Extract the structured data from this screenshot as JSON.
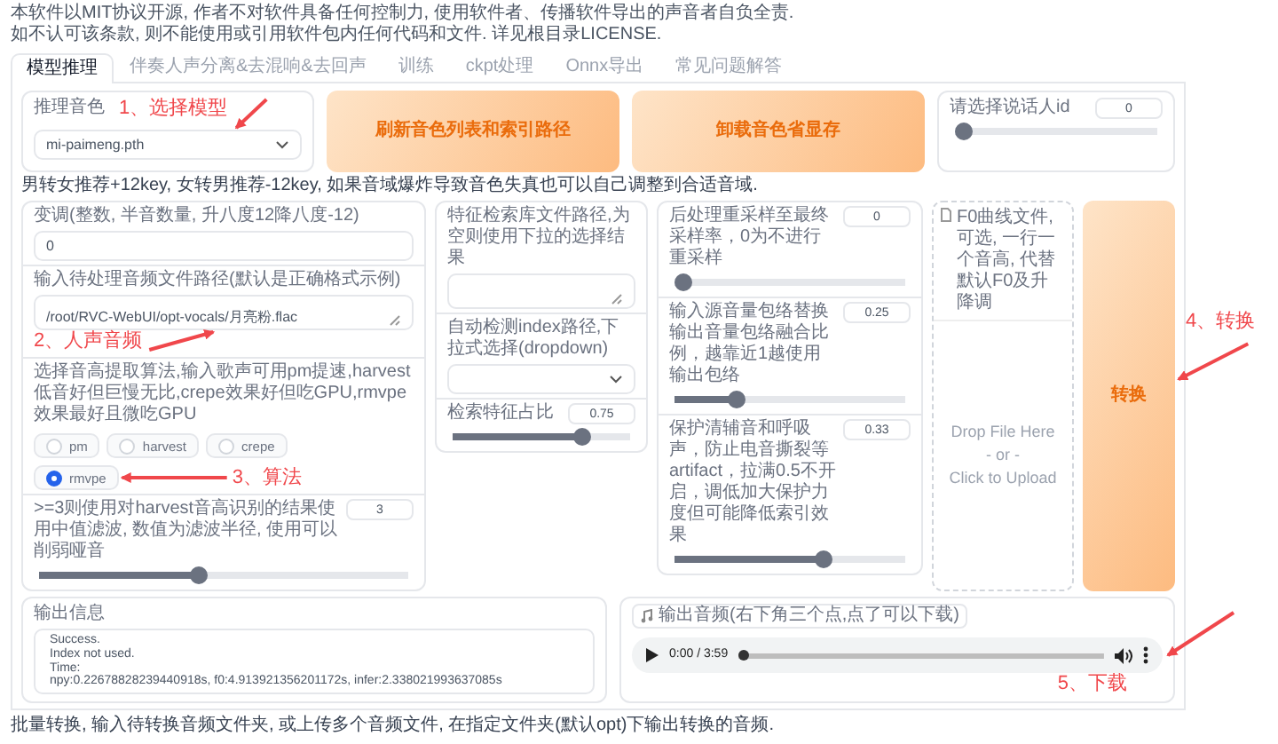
{
  "notice": [
    "本软件以MIT协议开源, 作者不对软件具备任何控制力, 使用软件者、传播软件导出的声音者自负全责.",
    "如不认可该条款, 则不能使用或引用软件包内任何代码和文件. 详见根目录LICENSE."
  ],
  "tabs": [
    {
      "label": "模型推理",
      "selected": true
    },
    {
      "label": "伴奏人声分离&去混响&去回声",
      "selected": false
    },
    {
      "label": "训练",
      "selected": false
    },
    {
      "label": "ckpt处理",
      "selected": false
    },
    {
      "label": "Onnx导出",
      "selected": false
    },
    {
      "label": "常见问题解答",
      "selected": false
    }
  ],
  "model": {
    "label": "推理音色",
    "value": "mi-paimeng.pth"
  },
  "buttons": [
    "刷新音色列表和索引路径",
    "卸载音色省显存"
  ],
  "speaker": {
    "label": "请选择说话人id",
    "value": "0",
    "level": 0
  },
  "hint": "男转女推荐+12key, 女转男推荐-12key, 如果音域爆炸导致音色失真也可以自己调整到合适音域.",
  "columns": [
    [
      {
        "kind": "number",
        "label": "变调(整数, 半音数量, 升八度12降八度-12)",
        "value": "0"
      },
      {
        "kind": "textbox",
        "label": "输入待处理音频文件路径(默认是正确格式示例)",
        "value": "/root/RVC-WebUI/opt-vocals/月亮粉.flac"
      },
      {
        "kind": "radio",
        "label": "选择音高提取算法,输入歌声可用pm提速,harvest低音好但巨慢无比,crepe效果好但吃GPU,rmvpe效果最好且微吃GPU",
        "options": [
          {
            "label": "pm",
            "selected": false
          },
          {
            "label": "harvest",
            "selected": false
          },
          {
            "label": "crepe",
            "selected": false
          },
          {
            "label": "rmvpe",
            "selected": true
          }
        ]
      },
      {
        "kind": "slider",
        "label": ">=3则使用对harvest音高识别的结果使用中值滤波, 数值为滤波半径, 使用可以削弱哑音",
        "value": "3",
        "level": 0.43
      }
    ],
    [
      {
        "kind": "textbox",
        "label": "特征检索库文件路径,为空则使用下拉的选择结果"
      },
      {
        "kind": "dropdown",
        "label": "自动检测index路径,下拉式选择(dropdown)"
      },
      {
        "kind": "slider",
        "label": "检索特征占比",
        "value": "0.75",
        "level": 0.75
      }
    ],
    [
      {
        "kind": "slider",
        "label": "后处理重采样至最终采样率，0为不进行重采样",
        "value": "0",
        "level": 0
      },
      {
        "kind": "slider",
        "label": "输入源音量包络替换输出音量包络融合比例，越靠近1越使用输出包络",
        "value": "0.25",
        "level": 0.25
      },
      {
        "kind": "slider",
        "label": "保护清辅音和呼吸声，防止电音撕裂等artifact，拉满0.5不开启，调低加大保护力度但可能降低索引效果",
        "value": "0.33",
        "level": 0.66
      }
    ]
  ],
  "f0_upload": {
    "label": "F0曲线文件, 可选, 一行一个音高, 代替默认F0及升降调",
    "lines": [
      "Drop File Here",
      "- or -",
      "Click to Upload"
    ]
  },
  "convert_button": "转换",
  "output_info": {
    "label": "输出信息",
    "lines": [
      "Success.",
      "Index not used.",
      "Time:",
      "npy:0.22678828239440918s, f0:4.913921356201172s, infer:2.338021993637085s"
    ]
  },
  "output_audio": {
    "label": "输出音频(右下角三个点,点了可以下载)",
    "time": "0:00 / 3:59",
    "level": 0
  },
  "batch_note": "批量转换, 输入待转换音频文件夹, 或上传多个音频文件, 在指定文件夹(默认opt)下输出转换的音频.",
  "annotations": [
    {
      "text": "1、选择模型"
    },
    {
      "text": "2、人声音频"
    },
    {
      "text": "3、算法"
    },
    {
      "text": "4、转换"
    },
    {
      "text": "5、下载"
    }
  ]
}
